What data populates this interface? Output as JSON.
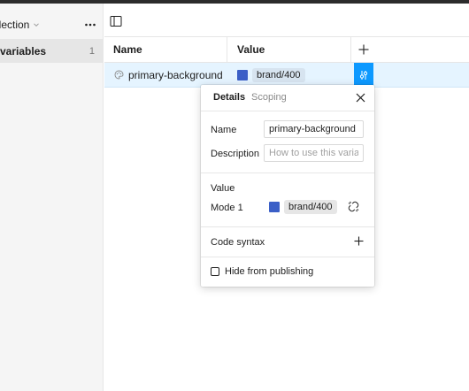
{
  "sidebar": {
    "collection_title": "llection",
    "items": [
      {
        "label": "variables",
        "count": "1"
      }
    ]
  },
  "table": {
    "columns": [
      "Name",
      "Value"
    ],
    "rows": [
      {
        "name": "primary-background",
        "value": "brand/400",
        "swatch_color": "#3b5fc7"
      }
    ]
  },
  "popover": {
    "tabs": [
      "Details",
      "Scoping"
    ],
    "name_label": "Name",
    "name_value": "primary-background",
    "description_label": "Description",
    "description_placeholder": "How to use this variable",
    "value_section_title": "Value",
    "mode_label": "Mode 1",
    "mode_value": "brand/400",
    "code_syntax_title": "Code syntax",
    "hide_from_publishing_label": "Hide from publishing"
  },
  "colors": {
    "accent": "#0d99ff",
    "swatch": "#3b5fc7",
    "row_selected": "#e5f4ff"
  },
  "icons": {
    "collection_dropdown": "chevron-down-icon",
    "more": "more-horizontal-icon",
    "panel_toggle": "sidebar-panel-icon",
    "add_column": "plus-icon",
    "variable_type": "color-palette-icon",
    "edit_variable": "adjust-sliders-icon",
    "close": "close-icon",
    "detach_alias": "unlink-icon",
    "add_code_syntax": "plus-icon"
  }
}
